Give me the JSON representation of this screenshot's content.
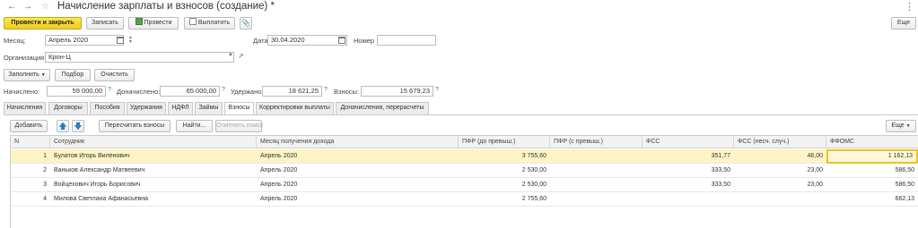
{
  "window": {
    "title": "Начисление зарплаты и взносов (создание) *",
    "more_menu": "⋮"
  },
  "toolbar": {
    "post_close": "Провести и закрыть",
    "save": "Записать",
    "post": "Провести",
    "pay": "Выплатить",
    "more": "Еще"
  },
  "form": {
    "month_label": "Месяц:",
    "month_value": "Апрель 2020",
    "date_label": "Дата:",
    "date_value": "30.04.2020",
    "number_label": "Номер",
    "number_value": "",
    "org_label": "Организация:",
    "org_value": "Крон-Ц"
  },
  "actions": {
    "fill": "Заполнить",
    "pick": "Подбор",
    "clear": "Очистить"
  },
  "totals": {
    "accrued_label": "Начислено:",
    "accrued_value": "59 000,00",
    "additional_label": "Доначислено:",
    "additional_value": "65 000,00",
    "withheld_label": "Удержано:",
    "withheld_value": "18 621,25",
    "contrib_label": "Взносы:",
    "contrib_value": "15 679,23",
    "help": "?"
  },
  "tabs": [
    "Начисления",
    "Договоры",
    "Пособия",
    "Удержания",
    "НДФЛ",
    "Займы",
    "Взносы",
    "Корректировки выплаты",
    "Доначисления, перерасчеты"
  ],
  "grid_toolbar": {
    "add": "Добавить",
    "recalc": "Пересчитать взносы",
    "find": "Найти...",
    "cancel_search": "Отменить поиск",
    "more": "Еще"
  },
  "grid": {
    "columns": [
      "N",
      "Сотрудник",
      "Месяц получения дохода",
      "ПФР (до превыш.)",
      "ПФР (с превыш.)",
      "ФСС",
      "ФСС (несч. случ.)",
      "ФФОМС"
    ],
    "rows": [
      {
        "n": "1",
        "employee": "Булатов Игорь Виленович",
        "month": "Апрель 2020",
        "pfr": "3 755,60",
        "pfr_over": "",
        "fss": "351,77",
        "fss_acc": "46,00",
        "ffoms": "1 162,13"
      },
      {
        "n": "2",
        "employee": "Ваньков Александр Матвеевич",
        "month": "Апрель 2020",
        "pfr": "2 530,00",
        "pfr_over": "",
        "fss": "333,50",
        "fss_acc": "23,00",
        "ffoms": "586,50"
      },
      {
        "n": "3",
        "employee": "Войцехович Игорь Борисович",
        "month": "Апрель 2020",
        "pfr": "2 530,00",
        "pfr_over": "",
        "fss": "333,50",
        "fss_acc": "23,00",
        "ffoms": "586,50"
      },
      {
        "n": "4",
        "employee": "Милова Светлана Афанасьевна",
        "month": "Апрель 2020",
        "pfr": "2 755,60",
        "pfr_over": "",
        "fss": "",
        "fss_acc": "",
        "ffoms": "662,13"
      }
    ]
  }
}
